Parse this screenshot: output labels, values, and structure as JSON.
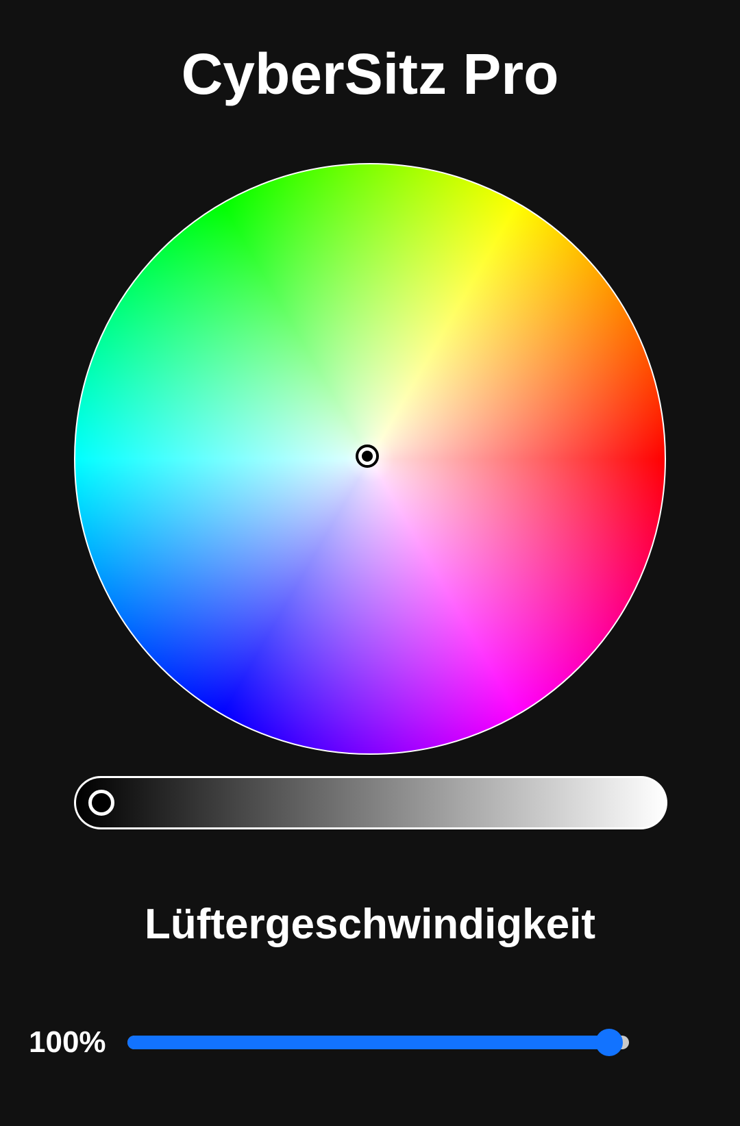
{
  "app": {
    "title": "CyberSitz Pro"
  },
  "color_picker": {
    "selected_color": "#ffffff",
    "brightness_level": 0
  },
  "fan": {
    "title": "Lüftergeschwindigkeit",
    "value_label": "100%",
    "level": 0.96,
    "accent_color": "#1273ff"
  }
}
